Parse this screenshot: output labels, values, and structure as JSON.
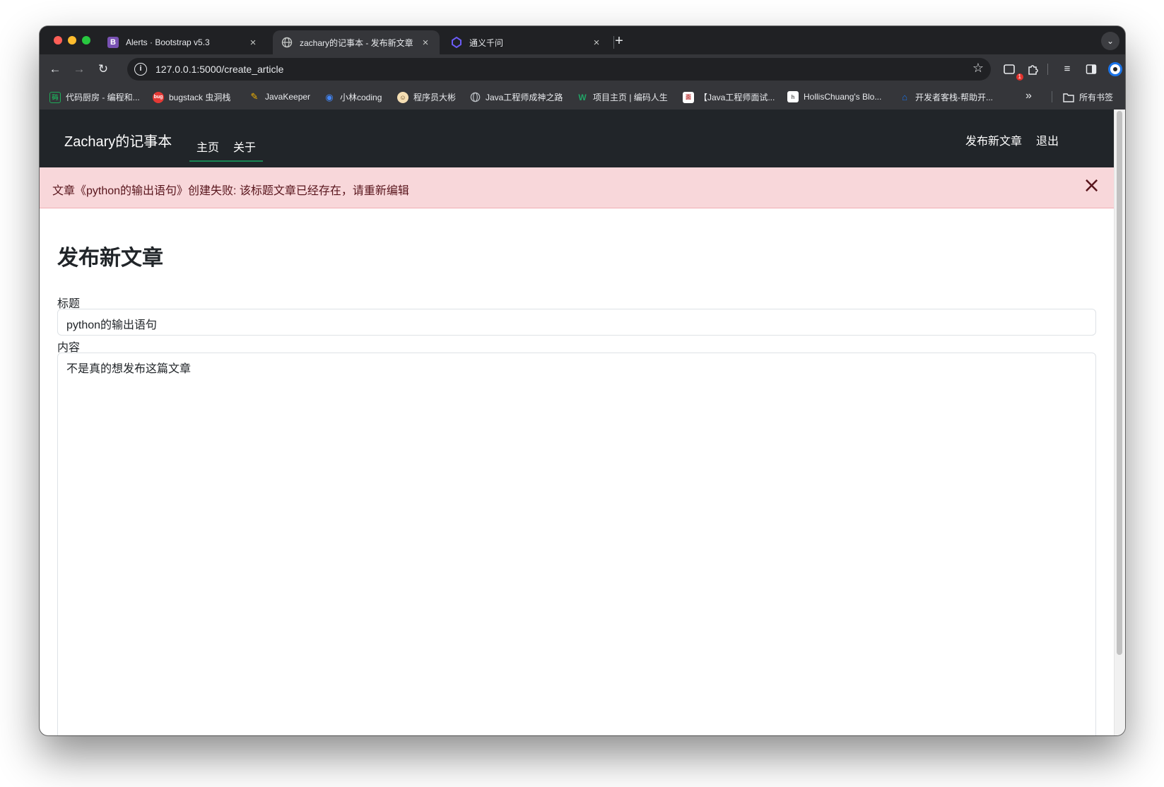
{
  "browser": {
    "tabs": [
      {
        "title": "Alerts · Bootstrap v5.3",
        "favicon_letter": "B",
        "favicon_color": "#7952b3"
      },
      {
        "title": "zachary的记事本 - 发布新文章",
        "favicon": "globe-icon"
      },
      {
        "title": "通义千问",
        "favicon": "tongyi-icon"
      }
    ],
    "url": "127.0.0.1:5000/create_article",
    "extension_badge": "1",
    "bookmarks": [
      {
        "label": "代码厨房 - 编程和...",
        "icon_color": "#1faa59"
      },
      {
        "label": "bugstack 虫洞栈",
        "icon_color": "#e53935"
      },
      {
        "label": "JavaKeeper",
        "icon_color": "#f4b400"
      },
      {
        "label": "小林coding",
        "icon_color": "#4285f4"
      },
      {
        "label": "程序员大彬",
        "icon_color": "#f5deb3"
      },
      {
        "label": "Java工程师成神之路",
        "icon_color": "#bdc1c6"
      },
      {
        "label": "项目主页 | 编码人生",
        "icon_color": "#21a366"
      },
      {
        "label": "【Java工程师面试...",
        "icon_color": "#ffffff"
      },
      {
        "label": "HollisChuang's Blo...",
        "icon_color": "#ffffff"
      },
      {
        "label": "开发者客栈-帮助开...",
        "icon_color": "#1a73e8"
      }
    ],
    "all_bookmarks_label": "所有书签"
  },
  "site": {
    "brand": "Zachary的记事本",
    "nav": {
      "home": "主页",
      "about": "关于"
    },
    "right_nav": {
      "publish": "发布新文章",
      "logout": "退出"
    },
    "accent_color": "#198754"
  },
  "alert": {
    "message": "文章《python的输出语句》创建失败: 该标题文章已经存在，请重新编辑",
    "bg_color": "#f8d7da"
  },
  "form": {
    "heading": "发布新文章",
    "title_label": "标题",
    "title_value": "python的输出语句",
    "content_label": "内容",
    "content_value": "不是真的想发布这篇文章"
  }
}
